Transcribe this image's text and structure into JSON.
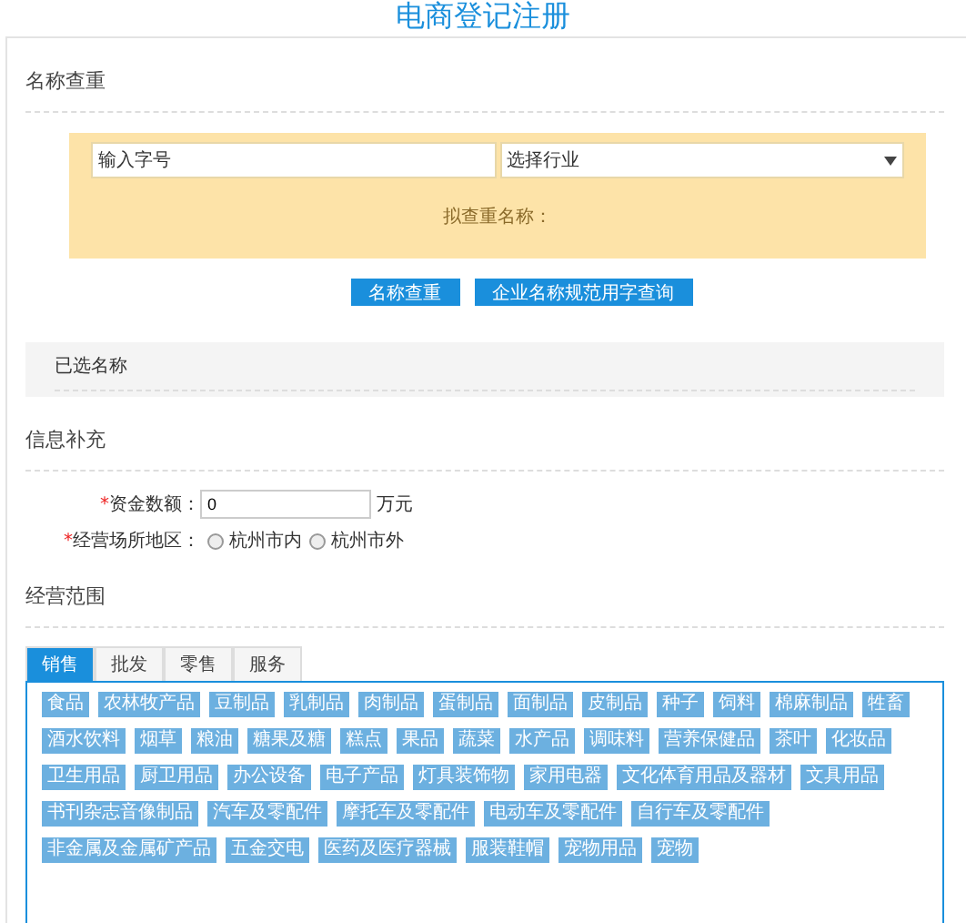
{
  "title": "电商登记注册",
  "name_check": {
    "heading": "名称查重",
    "name_field": {
      "placeholder": "输入字号"
    },
    "industry_select": {
      "value": "选择行业"
    },
    "proposed_name_label": "拟查重名称：",
    "buttons": [
      "名称查重",
      "企业名称规范用字查询"
    ]
  },
  "selected_names": {
    "heading": "已选名称"
  },
  "info": {
    "heading": "信息补充",
    "capital": {
      "marker": "*",
      "label": "资金数额：",
      "value": "0",
      "unit": "万元"
    },
    "location": {
      "marker": "*",
      "label": "经营场所地区：",
      "options": [
        {
          "label": "杭州市内",
          "selected": false
        },
        {
          "label": "杭州市外",
          "selected": false
        }
      ]
    }
  },
  "scope": {
    "heading": "经营范围",
    "tabs": [
      {
        "label": "销售",
        "selected": true
      },
      {
        "label": "批发",
        "selected": false
      },
      {
        "label": "零售",
        "selected": false
      },
      {
        "label": "服务",
        "selected": false
      }
    ],
    "tag_rows": [
      [
        "食品",
        "农林牧产品",
        "豆制品",
        "乳制品",
        "肉制品",
        "蛋制品",
        "面制品",
        "皮制品",
        "种子",
        "饲料",
        "棉麻制品",
        "牲畜"
      ],
      [
        "酒水饮料",
        "烟草",
        "粮油",
        "糖果及糖",
        "糕点",
        "果品",
        "蔬菜",
        "水产品",
        "调味料",
        "营养保健品",
        "茶叶",
        "化妆品"
      ],
      [
        "卫生用品",
        "厨卫用品",
        "办公设备",
        "电子产品",
        "灯具装饰物",
        "家用电器",
        "文化体育用品及器材",
        "文具用品"
      ],
      [
        "书刊杂志音像制品",
        "汽车及零配件",
        "摩托车及零配件",
        "电动车及零配件",
        "自行车及零配件"
      ],
      [
        "非金属及金属矿产品",
        "五金交电",
        "医药及医疗器械",
        "服装鞋帽",
        "宠物用品",
        "宠物"
      ]
    ]
  }
}
